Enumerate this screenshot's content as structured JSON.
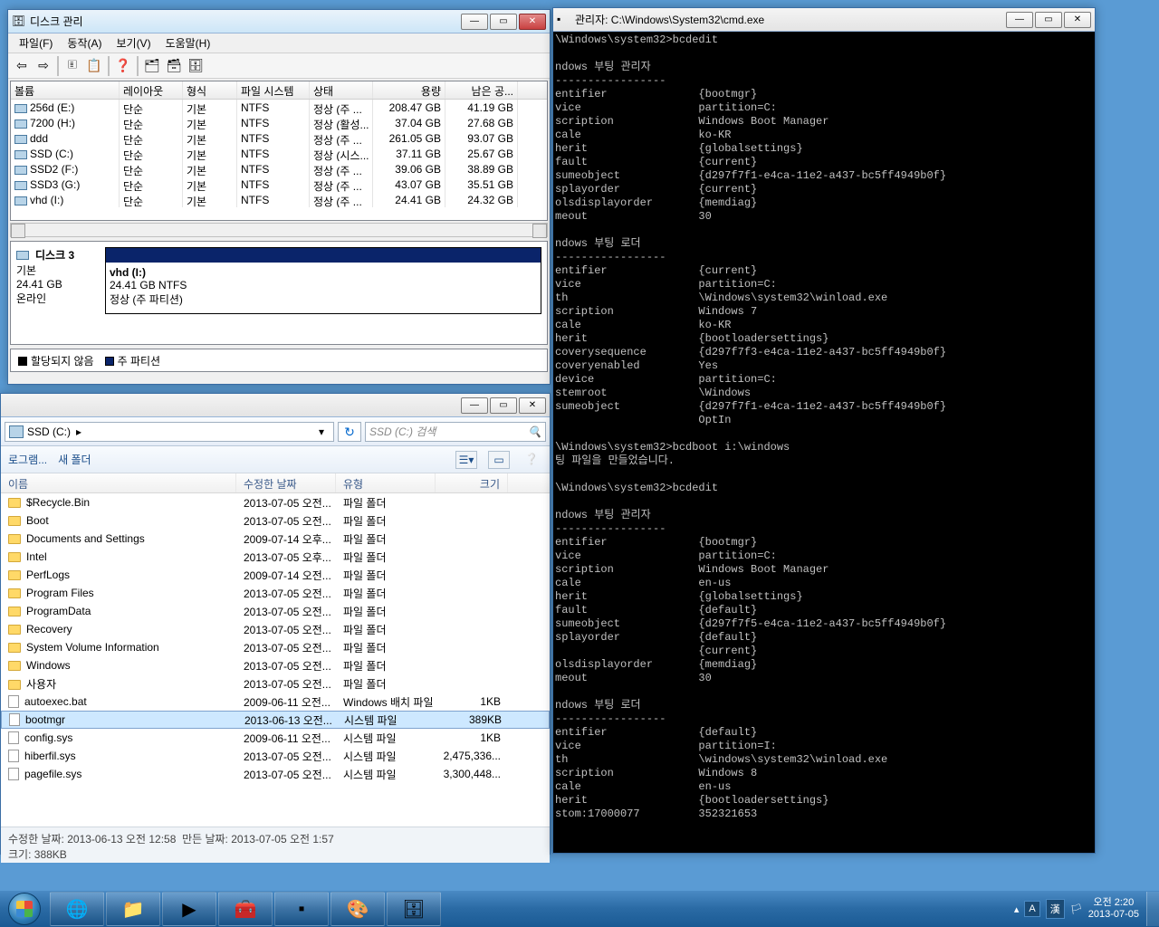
{
  "dm": {
    "title": "디스크 관리",
    "menu": {
      "file": "파일(F)",
      "action": "동작(A)",
      "view": "보기(V)",
      "help": "도움말(H)"
    },
    "cols": {
      "volume": "볼륨",
      "layout": "레이아웃",
      "type": "형식",
      "fs": "파일 시스템",
      "status": "상태",
      "capacity": "용량",
      "free": "남은 공..."
    },
    "rows": [
      {
        "vol": "256d (E:)",
        "lay": "단순",
        "typ": "기본",
        "fs": "NTFS",
        "stat": "정상 (주 ...",
        "cap": "208.47 GB",
        "free": "41.19 GB"
      },
      {
        "vol": "7200 (H:)",
        "lay": "단순",
        "typ": "기본",
        "fs": "NTFS",
        "stat": "정상 (활성...",
        "cap": "37.04 GB",
        "free": "27.68 GB"
      },
      {
        "vol": "ddd",
        "lay": "단순",
        "typ": "기본",
        "fs": "NTFS",
        "stat": "정상 (주 ...",
        "cap": "261.05 GB",
        "free": "93.07 GB"
      },
      {
        "vol": "SSD (C:)",
        "lay": "단순",
        "typ": "기본",
        "fs": "NTFS",
        "stat": "정상 (시스...",
        "cap": "37.11 GB",
        "free": "25.67 GB"
      },
      {
        "vol": "SSD2 (F:)",
        "lay": "단순",
        "typ": "기본",
        "fs": "NTFS",
        "stat": "정상 (주 ...",
        "cap": "39.06 GB",
        "free": "38.89 GB"
      },
      {
        "vol": "SSD3 (G:)",
        "lay": "단순",
        "typ": "기본",
        "fs": "NTFS",
        "stat": "정상 (주 ...",
        "cap": "43.07 GB",
        "free": "35.51 GB"
      },
      {
        "vol": "vhd (I:)",
        "lay": "단순",
        "typ": "기본",
        "fs": "NTFS",
        "stat": "정상 (주 ...",
        "cap": "24.41 GB",
        "free": "24.32 GB"
      }
    ],
    "disk": {
      "label": "디스크 3",
      "type": "기본",
      "size": "24.41 GB",
      "state": "온라인",
      "pname": "vhd  (I:)",
      "pinfo": "24.41 GB NTFS",
      "pstat": "정상 (주 파티션)"
    },
    "legend": {
      "unalloc": "할당되지 않음",
      "primary": "주 파티션"
    }
  },
  "ex": {
    "path": "SSD (C:)",
    "searchPlaceholder": "SSD (C:) 검색",
    "tb": {
      "prog": "로그램...",
      "newfolder": "새 폴더"
    },
    "cols": {
      "name": "이름",
      "date": "수정한 날짜",
      "type": "유형",
      "size": "크기"
    },
    "rows": [
      {
        "icon": "folder",
        "name": "$Recycle.Bin",
        "date": "2013-07-05 오전...",
        "type": "파일 폴더",
        "size": ""
      },
      {
        "icon": "folder",
        "name": "Boot",
        "date": "2013-07-05 오전...",
        "type": "파일 폴더",
        "size": ""
      },
      {
        "icon": "folder",
        "name": "Documents and Settings",
        "date": "2009-07-14 오후...",
        "type": "파일 폴더",
        "size": ""
      },
      {
        "icon": "folder",
        "name": "Intel",
        "date": "2013-07-05 오후...",
        "type": "파일 폴더",
        "size": ""
      },
      {
        "icon": "folder",
        "name": "PerfLogs",
        "date": "2009-07-14 오전...",
        "type": "파일 폴더",
        "size": ""
      },
      {
        "icon": "folder",
        "name": "Program Files",
        "date": "2013-07-05 오전...",
        "type": "파일 폴더",
        "size": ""
      },
      {
        "icon": "folder",
        "name": "ProgramData",
        "date": "2013-07-05 오전...",
        "type": "파일 폴더",
        "size": ""
      },
      {
        "icon": "folder",
        "name": "Recovery",
        "date": "2013-07-05 오전...",
        "type": "파일 폴더",
        "size": ""
      },
      {
        "icon": "folder",
        "name": "System Volume Information",
        "date": "2013-07-05 오전...",
        "type": "파일 폴더",
        "size": ""
      },
      {
        "icon": "folder",
        "name": "Windows",
        "date": "2013-07-05 오전...",
        "type": "파일 폴더",
        "size": ""
      },
      {
        "icon": "folder",
        "name": "사용자",
        "date": "2013-07-05 오전...",
        "type": "파일 폴더",
        "size": ""
      },
      {
        "icon": "file",
        "name": "autoexec.bat",
        "date": "2009-06-11 오전...",
        "type": "Windows 배치 파일",
        "size": "1KB"
      },
      {
        "icon": "file",
        "name": "bootmgr",
        "date": "2013-06-13 오전...",
        "type": "시스템 파일",
        "size": "389KB",
        "sel": true
      },
      {
        "icon": "file",
        "name": "config.sys",
        "date": "2009-06-11 오전...",
        "type": "시스템 파일",
        "size": "1KB"
      },
      {
        "icon": "file",
        "name": "hiberfil.sys",
        "date": "2013-07-05 오전...",
        "type": "시스템 파일",
        "size": "2,475,336..."
      },
      {
        "icon": "file",
        "name": "pagefile.sys",
        "date": "2013-07-05 오전...",
        "type": "시스템 파일",
        "size": "3,300,448..."
      }
    ],
    "status": {
      "moddate_lbl": "수정한 날짜:",
      "moddate": "2013-06-13 오전 12:58",
      "created_lbl": "만든 날짜:",
      "created": "2013-07-05 오전 1:57",
      "size_lbl": "크기:",
      "size": "388KB"
    }
  },
  "cmd": {
    "title": "관리자: C:\\Windows\\System32\\cmd.exe",
    "text": "\\Windows\\system32>bcdedit\n\nndows 부팅 관리자\n-----------------\nentifier              {bootmgr}\nvice                  partition=C:\nscription             Windows Boot Manager\ncale                  ko-KR\nherit                 {globalsettings}\nfault                 {current}\nsumeobject            {d297f7f1-e4ca-11e2-a437-bc5ff4949b0f}\nsplayorder            {current}\nolsdisplayorder       {memdiag}\nmeout                 30\n\nndows 부팅 로더\n-----------------\nentifier              {current}\nvice                  partition=C:\nth                    \\Windows\\system32\\winload.exe\nscription             Windows 7\ncale                  ko-KR\nherit                 {bootloadersettings}\ncoverysequence        {d297f7f3-e4ca-11e2-a437-bc5ff4949b0f}\ncoveryenabled         Yes\ndevice                partition=C:\nstemroot              \\Windows\nsumeobject            {d297f7f1-e4ca-11e2-a437-bc5ff4949b0f}\n                      OptIn\n\n\\Windows\\system32>bcdboot i:\\windows\n팅 파일을 만들었습니다.\n\n\\Windows\\system32>bcdedit\n\nndows 부팅 관리자\n-----------------\nentifier              {bootmgr}\nvice                  partition=C:\nscription             Windows Boot Manager\ncale                  en-us\nherit                 {globalsettings}\nfault                 {default}\nsumeobject            {d297f7f5-e4ca-11e2-a437-bc5ff4949b0f}\nsplayorder            {default}\n                      {current}\nolsdisplayorder       {memdiag}\nmeout                 30\n\nndows 부팅 로더\n-----------------\nentifier              {default}\nvice                  partition=I:\nth                    \\windows\\system32\\winload.exe\nscription             Windows 8\ncale                  en-us\nherit                 {bootloadersettings}\nstom:17000077         352321653"
  },
  "taskbar": {
    "ime1": "A",
    "ime2": "漢",
    "time": "오전 2:20",
    "date": "2013-07-05"
  }
}
